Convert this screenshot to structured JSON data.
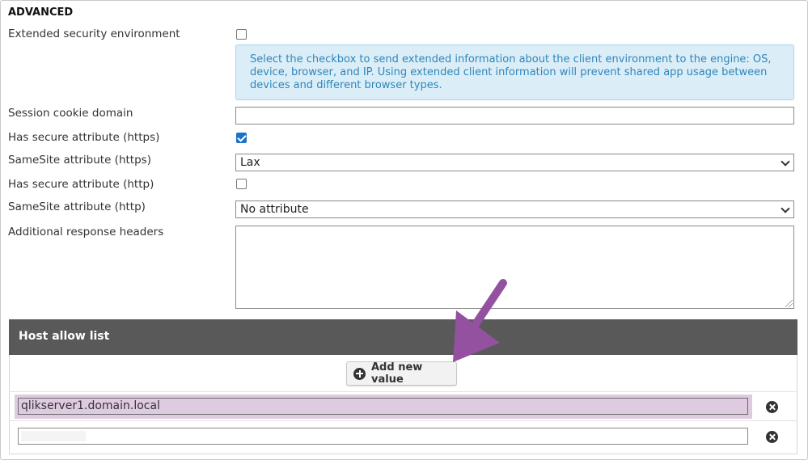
{
  "section": {
    "title": "ADVANCED"
  },
  "fields": {
    "extended_security": {
      "label": "Extended security environment",
      "checked": false
    },
    "info_text": "Select the checkbox to send extended information about the client environment to the engine: OS, device, browser, and IP. Using extended client information will prevent shared app usage between devices and different browser types.",
    "session_cookie_domain": {
      "label": "Session cookie domain",
      "value": ""
    },
    "secure_https": {
      "label": "Has secure attribute (https)",
      "checked": true
    },
    "samesite_https": {
      "label": "SameSite attribute (https)",
      "value": "Lax"
    },
    "secure_http": {
      "label": "Has secure attribute (http)",
      "checked": false
    },
    "samesite_http": {
      "label": "SameSite attribute (http)",
      "value": "No attribute"
    },
    "additional_headers": {
      "label": "Additional response headers",
      "value": ""
    }
  },
  "host_allow_list": {
    "title": "Host allow list",
    "add_button_label": "Add new value",
    "entries": [
      "qlikserver1.domain.local",
      ""
    ]
  },
  "colors": {
    "header_bg": "#595959",
    "info_bg": "#dbeef8",
    "info_text": "#2f86b9",
    "highlight": "#dfcbe0",
    "annotation_arrow": "#9351a0",
    "checkbox_checked": "#1a73c8"
  },
  "icons": {
    "add": "plus-circle-icon",
    "remove": "close-circle-icon",
    "dropdown": "chevron-down-icon",
    "annotation": "arrow-annotation-icon"
  }
}
